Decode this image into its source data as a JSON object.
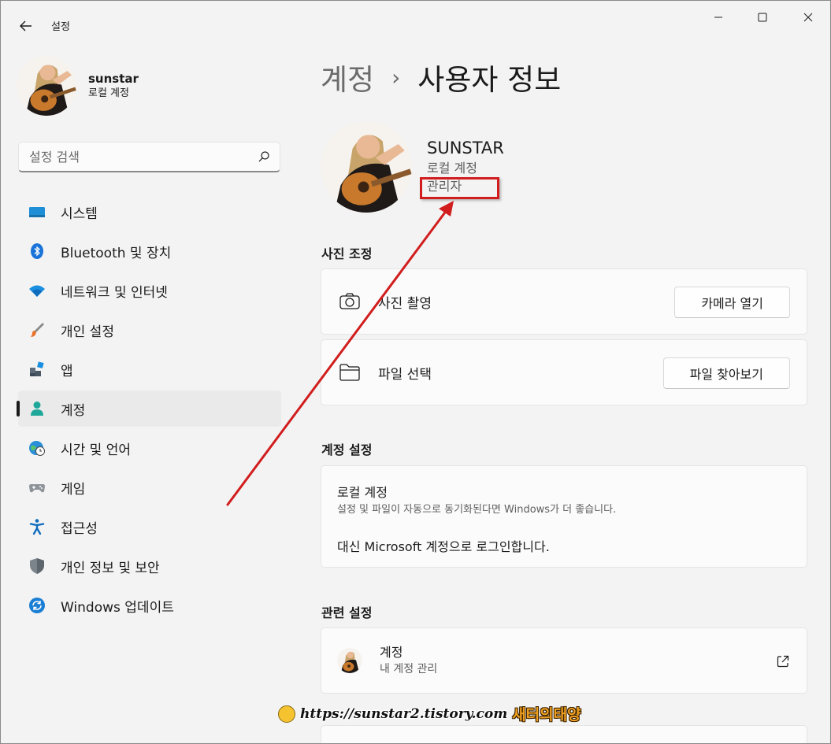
{
  "window": {
    "title": "설정",
    "controls": [
      "minimize",
      "maximize",
      "close"
    ]
  },
  "sidebar": {
    "profile": {
      "name": "sunstar",
      "account_type": "로컬 계정"
    },
    "search": {
      "placeholder": "설정 검색"
    },
    "items": [
      {
        "label": "시스템",
        "icon": "monitor-icon"
      },
      {
        "label": "Bluetooth 및 장치",
        "icon": "bluetooth-icon"
      },
      {
        "label": "네트워크 및 인터넷",
        "icon": "wifi-icon"
      },
      {
        "label": "개인 설정",
        "icon": "brush-icon"
      },
      {
        "label": "앱",
        "icon": "apps-icon"
      },
      {
        "label": "계정",
        "icon": "person-icon",
        "active": true
      },
      {
        "label": "시간 및 언어",
        "icon": "globe-clock-icon"
      },
      {
        "label": "게임",
        "icon": "gamepad-icon"
      },
      {
        "label": "접근성",
        "icon": "accessibility-icon"
      },
      {
        "label": "개인 정보 및 보안",
        "icon": "shield-icon"
      },
      {
        "label": "Windows 업데이트",
        "icon": "update-icon"
      }
    ]
  },
  "main": {
    "breadcrumb": {
      "parent": "계정",
      "separator": "›",
      "current": "사용자 정보"
    },
    "user": {
      "name": "SUNSTAR",
      "account_type": "로컬 계정",
      "role": "관리자"
    },
    "photo_section": {
      "title": "사진 조정",
      "take_photo": {
        "label": "사진 촬영",
        "button": "카메라 열기"
      },
      "choose_file": {
        "label": "파일 선택",
        "button": "파일 찾아보기"
      }
    },
    "account_settings": {
      "title": "계정 설정",
      "local_title": "로컬 계정",
      "local_desc": "설정 및 파일이 자동으로 동기화된다면 Windows가 더 좋습니다.",
      "microsoft_link": "대신 Microsoft 계정으로 로그인합니다."
    },
    "related_settings": {
      "title": "관련 설정",
      "accounts": {
        "title": "계정",
        "subtitle": "내 계정 관리"
      }
    }
  },
  "annotation": {
    "highlight_color": "#d11d1d"
  },
  "watermark": {
    "url": "https://sunstar2.tistory.com",
    "brand": "새터의태양"
  }
}
